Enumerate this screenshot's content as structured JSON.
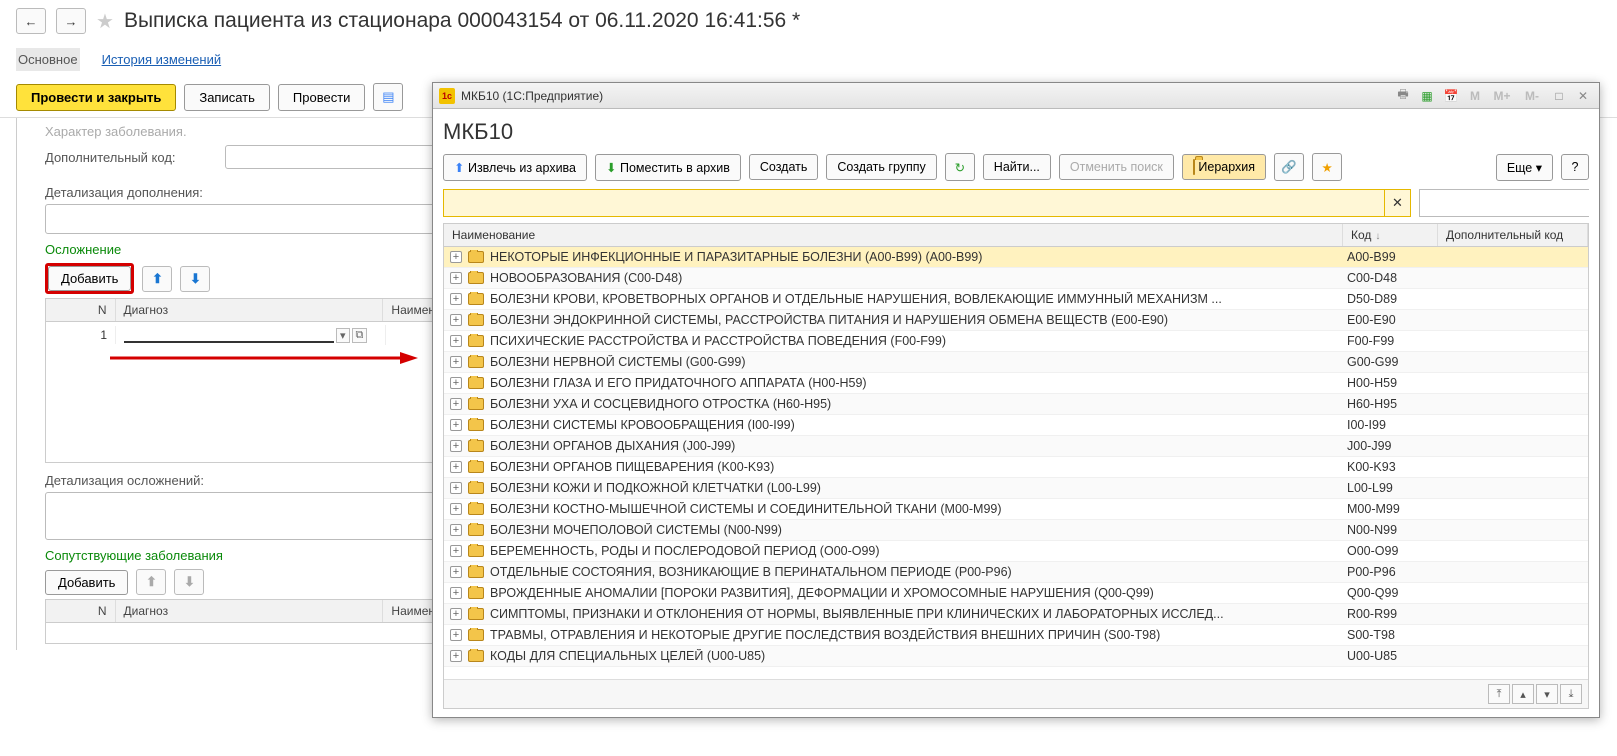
{
  "header": {
    "title": "Выписка пациента из стационара 000043154 от 06.11.2020 16:41:56 *"
  },
  "tabs": {
    "main": "Основное",
    "history": "История изменений"
  },
  "toolbar": {
    "post_close": "Провести и закрыть",
    "write": "Записать",
    "post": "Провести"
  },
  "form": {
    "char_label_trunc": "Характер заболевания.",
    "addcode_label": "Дополнительный код:",
    "detail_add_label": "Детализация дополнения:",
    "complication_title": "Осложнение",
    "add_btn": "Добавить",
    "col_n": "N",
    "col_diag": "Диагноз",
    "col_naim": "Наимен",
    "row_n": "1",
    "detail_compl_label": "Детализация осложнений:",
    "accomp_title": "Сопутствующие заболевания"
  },
  "dialog": {
    "window_title": "МКБ10  (1С:Предприятие)",
    "title": "МКБ10",
    "tb": {
      "extract": "Извлечь из архива",
      "archive": "Поместить в архив",
      "create": "Создать",
      "create_group": "Создать группу",
      "find": "Найти...",
      "cancel_search": "Отменить поиск",
      "hierarchy": "Иерархия",
      "more": "Еще",
      "help": "?"
    },
    "cols": {
      "name": "Наименование",
      "code": "Код",
      "extra": "Дополнительный код"
    },
    "rows": [
      {
        "name": "НЕКОТОРЫЕ ИНФЕКЦИОННЫЕ И ПАРАЗИТАРНЫЕ БОЛЕЗНИ (A00-B99) (A00-B99)",
        "code": "A00-B99",
        "sel": true
      },
      {
        "name": "НОВООБРАЗОВАНИЯ (C00-D48)",
        "code": "C00-D48"
      },
      {
        "name": "БОЛЕЗНИ КРОВИ, КРОВЕТВОРНЫХ ОРГАНОВ И ОТДЕЛЬНЫЕ НАРУШЕНИЯ, ВОВЛЕКАЮЩИЕ ИММУННЫЙ МЕХАНИЗМ ...",
        "code": "D50-D89"
      },
      {
        "name": "БОЛЕЗНИ ЭНДОКРИННОЙ СИСТЕМЫ, РАССТРОЙСТВА ПИТАНИЯ И НАРУШЕНИЯ ОБМЕНА ВЕЩЕСТВ (E00-E90)",
        "code": "E00-E90"
      },
      {
        "name": "ПСИХИЧЕСКИЕ РАССТРОЙСТВА И РАССТРОЙСТВА ПОВЕДЕНИЯ (F00-F99)",
        "code": "F00-F99"
      },
      {
        "name": "БОЛЕЗНИ НЕРВНОЙ СИСТЕМЫ (G00-G99)",
        "code": "G00-G99"
      },
      {
        "name": "БОЛЕЗНИ ГЛАЗА И ЕГО ПРИДАТОЧНОГО АППАРАТА (H00-H59)",
        "code": "H00-H59"
      },
      {
        "name": "БОЛЕЗНИ УХА И СОСЦЕВИДНОГО ОТРОСТКА (H60-H95)",
        "code": "H60-H95"
      },
      {
        "name": "БОЛЕЗНИ СИСТЕМЫ КРОВООБРАЩЕНИЯ (I00-I99)",
        "code": "I00-I99"
      },
      {
        "name": "БОЛЕЗНИ ОРГАНОВ ДЫХАНИЯ (J00-J99)",
        "code": "J00-J99"
      },
      {
        "name": "БОЛЕЗНИ ОРГАНОВ ПИЩЕВАРЕНИЯ (K00-K93)",
        "code": "K00-K93"
      },
      {
        "name": "БОЛЕЗНИ КОЖИ И ПОДКОЖНОЙ КЛЕТЧАТКИ (L00-L99)",
        "code": "L00-L99"
      },
      {
        "name": "БОЛЕЗНИ КОСТНО-МЫШЕЧНОЙ СИСТЕМЫ И СОЕДИНИТЕЛЬНОЙ ТКАНИ (M00-M99)",
        "code": "M00-M99"
      },
      {
        "name": "БОЛЕЗНИ МОЧЕПОЛОВОЙ СИСТЕМЫ (N00-N99)",
        "code": "N00-N99"
      },
      {
        "name": "БЕРЕМЕННОСТЬ, РОДЫ И ПОСЛЕРОДОВОЙ ПЕРИОД (O00-O99)",
        "code": "O00-O99"
      },
      {
        "name": "ОТДЕЛЬНЫЕ СОСТОЯНИЯ, ВОЗНИКАЮЩИЕ В ПЕРИНАТАЛЬНОМ ПЕРИОДЕ (P00-P96)",
        "code": "P00-P96"
      },
      {
        "name": "ВРОЖДЕННЫЕ АНОМАЛИИ [ПОРОКИ РАЗВИТИЯ], ДЕФОРМАЦИИ И ХРОМОСОМНЫЕ НАРУШЕНИЯ (Q00-Q99)",
        "code": "Q00-Q99"
      },
      {
        "name": "СИМПТОМЫ, ПРИЗНАКИ И ОТКЛОНЕНИЯ ОТ НОРМЫ, ВЫЯВЛЕННЫЕ ПРИ КЛИНИЧЕСКИХ И ЛАБОРАТОРНЫХ ИССЛЕД...",
        "code": "R00-R99"
      },
      {
        "name": "ТРАВМЫ, ОТРАВЛЕНИЯ И НЕКОТОРЫЕ ДРУГИЕ ПОСЛЕДСТВИЯ ВОЗДЕЙСТВИЯ ВНЕШНИХ ПРИЧИН (S00-T98)",
        "code": "S00-T98"
      },
      {
        "name": "КОДЫ ДЛЯ СПЕЦИАЛЬНЫХ ЦЕЛЕЙ (U00-U85)",
        "code": "U00-U85"
      }
    ],
    "titlebar_m": {
      "m": "M",
      "mplus": "M+",
      "mminus": "M-"
    }
  }
}
